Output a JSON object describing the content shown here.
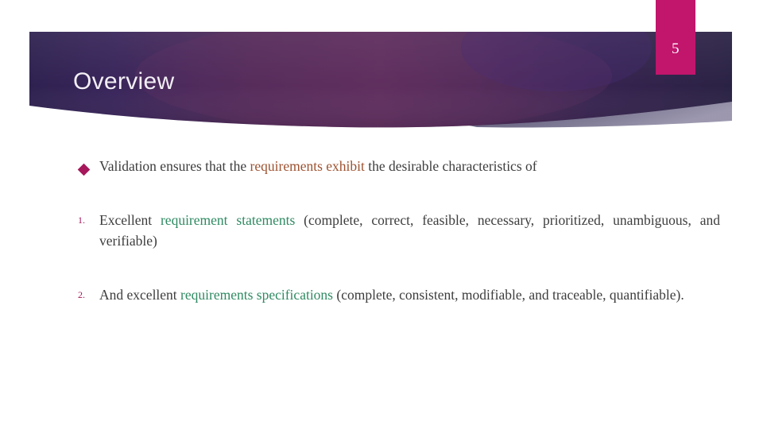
{
  "slide": {
    "title": "Overview",
    "number": "5",
    "colors": {
      "banner_left": "#2e2150",
      "banner_mid": "#5a2c5a",
      "banner_right": "#2a2244",
      "banner_wedge": "#6b6585",
      "number_box": "#c2156c",
      "bullet_marker": "#a6175b",
      "body_text": "#3d3d3d",
      "highlight_rust": "#9d5230",
      "highlight_green": "#2f8a62"
    }
  },
  "body": {
    "blocks": [
      {
        "marker_type": "diamond",
        "marker": "",
        "runs": [
          {
            "text": "Validation ensures that the ",
            "style": "plain"
          },
          {
            "text": "requirements exhibit",
            "style": "rust"
          },
          {
            "text": " the desirable characteristics of",
            "style": "plain"
          }
        ]
      },
      {
        "marker_type": "number",
        "marker": "1.",
        "runs": [
          {
            "text": "Excellent ",
            "style": "plain"
          },
          {
            "text": "requirement statements",
            "style": "green"
          },
          {
            "text": " (complete, correct, feasible, necessary, prioritized, unambiguous, and verifiable)",
            "style": "plain"
          }
        ]
      },
      {
        "marker_type": "number",
        "marker": "2.",
        "runs": [
          {
            "text": "And excellent ",
            "style": "plain"
          },
          {
            "text": "requirements specifications",
            "style": "green"
          },
          {
            "text": " (complete, consistent, modifiable, and traceable, quantifiable).",
            "style": "plain"
          }
        ]
      }
    ]
  }
}
